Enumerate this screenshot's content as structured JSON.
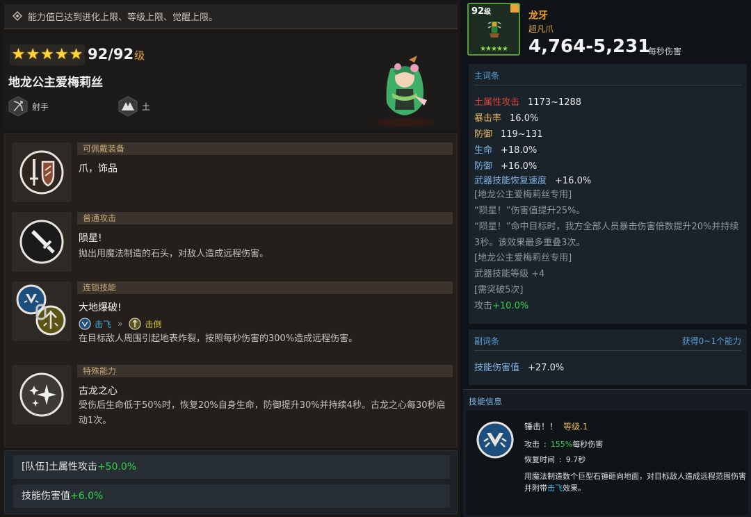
{
  "left": {
    "notice": "能力值已达到进化上限、等级上限、觉醒上限。",
    "hero": {
      "stars": 5,
      "level": "92/92",
      "level_unit": "级",
      "name": "地龙公主爱梅莉丝",
      "class_label": "射手",
      "element_label": "土"
    },
    "skills": [
      {
        "header": "可佩戴装备",
        "title": "爪，饰品",
        "desc": ""
      },
      {
        "header": "普通攻击",
        "title": "陨星!",
        "desc": "抛出用魔法制造的石头，对敌人造成远程伤害。"
      },
      {
        "header": "连锁技能",
        "title": "大地爆破!",
        "chain_from": "击飞",
        "chain_arrow": "»",
        "chain_to": "击倒",
        "desc": "在目标敌人周围引起地表炸裂，按照每秒伤害的300%造成远程伤害。"
      },
      {
        "header": "特殊能力",
        "title": "古龙之心",
        "desc": "受伤后生命低于50%时，恢复20%自身生命，防御提升30%并持续4秒。古龙之心每30秒启动1次。"
      }
    ],
    "team": [
      {
        "label": "[队伍]土属性攻击",
        "value": "+50.0%"
      },
      {
        "label": "技能伤害值",
        "value": "+6.0%"
      }
    ]
  },
  "right": {
    "weapon": {
      "level": "92",
      "level_unit": "级",
      "stars": "★★★★★",
      "name": "龙牙",
      "type": "超凡爪",
      "dps": "4,764-5,231",
      "dps_unit": "每秒伤害"
    },
    "main_options": {
      "title": "主词条",
      "stats": [
        {
          "key": "土属性攻击",
          "value": "1173~1288"
        },
        {
          "key": "暴击率",
          "value": "16.0%"
        },
        {
          "key": "防御",
          "value": "119~131"
        },
        {
          "key": "生命",
          "value": "+18.0%"
        },
        {
          "key": "防御",
          "value": "+16.0%"
        },
        {
          "key": "武器技能恢复速度",
          "value": "+16.0%"
        }
      ],
      "exclusive1_title": "[地龙公主爱梅莉丝专用]",
      "exclusive1_line1": "“陨星！”伤害值提升25%。",
      "exclusive1_line2": "“陨星！”命中目标时，我方全部人员暴击伤害倍数提升20%并持续3秒。该效果最多重叠3次。",
      "exclusive2_title": "[地龙公主爱梅莉丝专用]",
      "exclusive2_line1": "武器技能等级  +4",
      "exclusive2_line2": "[需突破5次]",
      "exclusive2_line3_label": "攻击",
      "exclusive2_line3_value": "+10.0%"
    },
    "sub_options": {
      "title": "副词条",
      "right_label": "获得0~1个能力",
      "stat_key": "技能伤害值",
      "stat_value": "+27.0%"
    },
    "skill_info": {
      "title": "技能信息",
      "name": "锤击！！",
      "level": "等级.1",
      "attack_label": "攻击",
      "attack_value": "155%",
      "attack_unit": "每秒伤害",
      "cooldown_label": "恢复时间",
      "cooldown_value": "9.7秒",
      "desc_before": "用魔法制造数个巨型石锤砸向地面，对目标敌人造成远程范围伤害并附带",
      "desc_highlight": "击飞",
      "desc_after": "效果。"
    }
  }
}
